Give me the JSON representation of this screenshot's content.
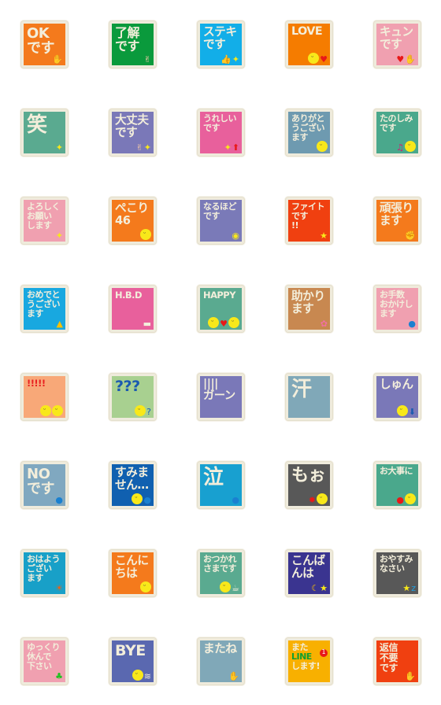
{
  "text_color": "#f3eedb",
  "stickers": [
    {
      "lines": [
        "OK",
        "です"
      ],
      "bg": "#f47a1c",
      "icons": [
        "ok-hand"
      ]
    },
    {
      "lines": [
        "了解",
        "です"
      ],
      "bg": "#0a9a3c",
      "icons": [
        "peace-hand"
      ]
    },
    {
      "lines": [
        "ステキ",
        "です"
      ],
      "bg": "#12aee8",
      "icons": [
        "thumbs-up",
        "sparkle"
      ]
    },
    {
      "lines": [
        "LOVE"
      ],
      "bg": "#f57c00",
      "icons": [
        "smiley",
        "heart"
      ]
    },
    {
      "lines": [
        "キュン",
        "です"
      ],
      "bg": "#f0a0b0",
      "icons": [
        "heart",
        "hand"
      ]
    },
    {
      "lines": [
        "笑"
      ],
      "bg": "#5aaa90",
      "icons": [
        "sparkle"
      ]
    },
    {
      "lines": [
        "大丈夫",
        "です"
      ],
      "bg": "#7a78b8",
      "icons": [
        "peace-hand",
        "sparkle"
      ]
    },
    {
      "lines": [
        "うれしい",
        "です"
      ],
      "bg": "#e8609c",
      "icons": [
        "sparkle",
        "up-arrow"
      ]
    },
    {
      "lines": [
        "ありがと",
        "うござい",
        "ます"
      ],
      "bg": "#6e9ab0",
      "icons": [
        "smiley"
      ]
    },
    {
      "lines": [
        "たのしみ",
        "です"
      ],
      "bg": "#4aa88c",
      "icons": [
        "music-note",
        "smiley"
      ]
    },
    {
      "lines": [
        "よろしく",
        "お願い",
        "します"
      ],
      "bg": "#f0a0b0",
      "icons": [
        "sparkle"
      ]
    },
    {
      "lines": [
        "ぺこり",
        "46"
      ],
      "bg": "#f47a1c",
      "icons": [
        "smiley"
      ]
    },
    {
      "lines": [
        "なるほど",
        "です"
      ],
      "bg": "#7a7ab8",
      "icons": [
        "lightbulb"
      ]
    },
    {
      "lines": [
        "ファイト",
        "です",
        "!!"
      ],
      "bg": "#f04010",
      "icons": [
        "star"
      ]
    },
    {
      "lines": [
        "頑張り",
        "ます"
      ],
      "bg": "#f47a1c",
      "icons": [
        "flexed-arm"
      ]
    },
    {
      "lines": [
        "おめでと",
        "うござい",
        "ます"
      ],
      "bg": "#18a8e0",
      "icons": [
        "party-popper"
      ]
    },
    {
      "lines": [
        "H.B.D"
      ],
      "bg": "#e8609c",
      "icons": [
        "cake"
      ]
    },
    {
      "lines": [
        "HAPPY"
      ],
      "bg": "#5aaa90",
      "icons": [
        "smiley",
        "heart",
        "smiley"
      ]
    },
    {
      "lines": [
        "助かり",
        "ます"
      ],
      "bg": "#c88850",
      "icons": [
        "flower"
      ]
    },
    {
      "lines": [
        "お手数",
        "おかけし",
        "ます"
      ],
      "bg": "#f0a0b0",
      "icons": [
        "drops"
      ]
    },
    {
      "lines": [
        "!!!!!"
      ],
      "bg": "#f8a878",
      "fg": "#e82020",
      "icons": [
        "smiley",
        "smiley"
      ]
    },
    {
      "lines": [
        "???"
      ],
      "bg": "#a8d090",
      "fg": "#1a5ab0",
      "icons": [
        "smiley",
        "question-mark"
      ]
    },
    {
      "lines": [
        "||||",
        "ガーン"
      ],
      "bg": "#7a78b8",
      "icons": []
    },
    {
      "lines": [
        "汗"
      ],
      "bg": "#80a8b8",
      "icons": []
    },
    {
      "lines": [
        "しゅん"
      ],
      "bg": "#7a78b8",
      "icons": [
        "smiley",
        "down-arrow"
      ]
    },
    {
      "lines": [
        "NO",
        "です"
      ],
      "bg": "#80a8c0",
      "icons": [
        "drops"
      ]
    },
    {
      "lines": [
        "すみま",
        "せん…"
      ],
      "bg": "#1060b0",
      "icons": [
        "smiley",
        "drops"
      ]
    },
    {
      "lines": [
        "泣"
      ],
      "bg": "#18a0d0",
      "icons": [
        "drops"
      ]
    },
    {
      "lines": [
        "もぉ"
      ],
      "bg": "#585858",
      "icons": [
        "anger",
        "smiley"
      ]
    },
    {
      "lines": [
        "お大事に"
      ],
      "bg": "#4aa88c",
      "icons": [
        "apple",
        "smiley"
      ]
    },
    {
      "lines": [
        "おはよう",
        "ござい",
        "ます"
      ],
      "bg": "#18a0c8",
      "icons": [
        "sun"
      ]
    },
    {
      "lines": [
        "こんに",
        "ちは"
      ],
      "bg": "#f47a1c",
      "icons": [
        "smiley"
      ]
    },
    {
      "lines": [
        "おつかれ",
        "さまです"
      ],
      "bg": "#5aaa90",
      "icons": [
        "smiley",
        "coffee-cup"
      ]
    },
    {
      "lines": [
        "こんば",
        "んは"
      ],
      "bg": "#3a3490",
      "icons": [
        "moon",
        "star"
      ]
    },
    {
      "lines": [
        "おやすみ",
        "なさい"
      ],
      "bg": "#585858",
      "icons": [
        "star",
        "zzz"
      ]
    },
    {
      "lines": [
        "ゆっくり",
        "休んで",
        "下さい"
      ],
      "bg": "#f0a0b0",
      "icons": [
        "sprout"
      ]
    },
    {
      "lines": [
        "BYE"
      ],
      "bg": "#5a68b0",
      "icons": [
        "smiley",
        "wind"
      ]
    },
    {
      "lines": [
        "またね"
      ],
      "bg": "#80a8b8",
      "icons": [
        "hands"
      ]
    },
    {
      "lines": [
        "また",
        "LINE",
        "します!"
      ],
      "bg": "#f8b000",
      "icons": [
        "notification-badge"
      ],
      "badge": "1"
    },
    {
      "lines": [
        "返信",
        "不要",
        "です"
      ],
      "bg": "#f04010",
      "icons": [
        "hand"
      ]
    }
  ]
}
